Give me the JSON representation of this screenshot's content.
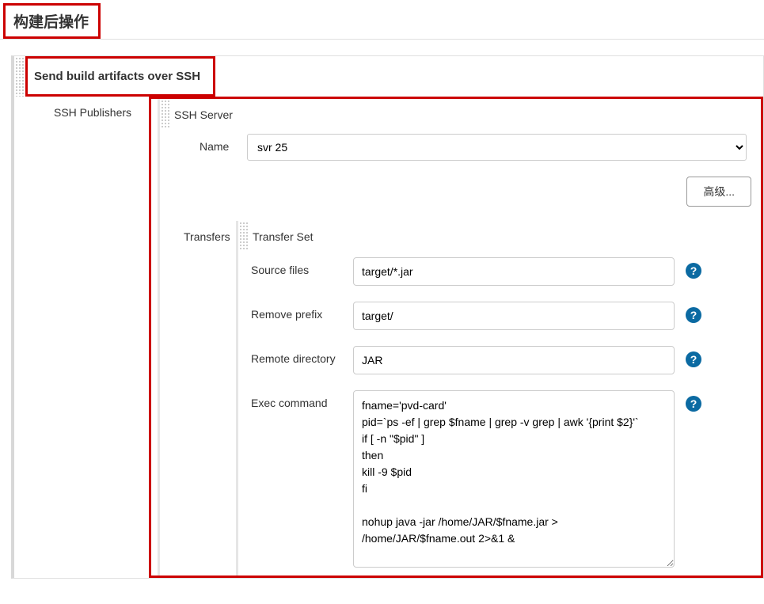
{
  "page": {
    "header": "构建后操作"
  },
  "section": {
    "title": "Send build artifacts over SSH",
    "ssh_publishers_label": "SSH Publishers",
    "ssh_server_label": "SSH Server",
    "name_label": "Name",
    "name_value": "svr 25",
    "advanced_button": "高级...",
    "transfers_label": "Transfers",
    "transfer_set_label": "Transfer Set",
    "fields": {
      "source_files": {
        "label": "Source files",
        "value": "target/*.jar"
      },
      "remove_prefix": {
        "label": "Remove prefix",
        "value": "target/"
      },
      "remote_directory": {
        "label": "Remote directory",
        "value": "JAR"
      },
      "exec_command": {
        "label": "Exec command",
        "value": "fname='pvd-card'\npid=`ps -ef | grep $fname | grep -v grep | awk '{print $2}'`\nif [ -n \"$pid\" ]\nthen\nkill -9 $pid\nfi\n\nnohup java -jar /home/JAR/$fname.jar > /home/JAR/$fname.out 2>&1 &"
      }
    }
  },
  "icons": {
    "help": "?"
  }
}
